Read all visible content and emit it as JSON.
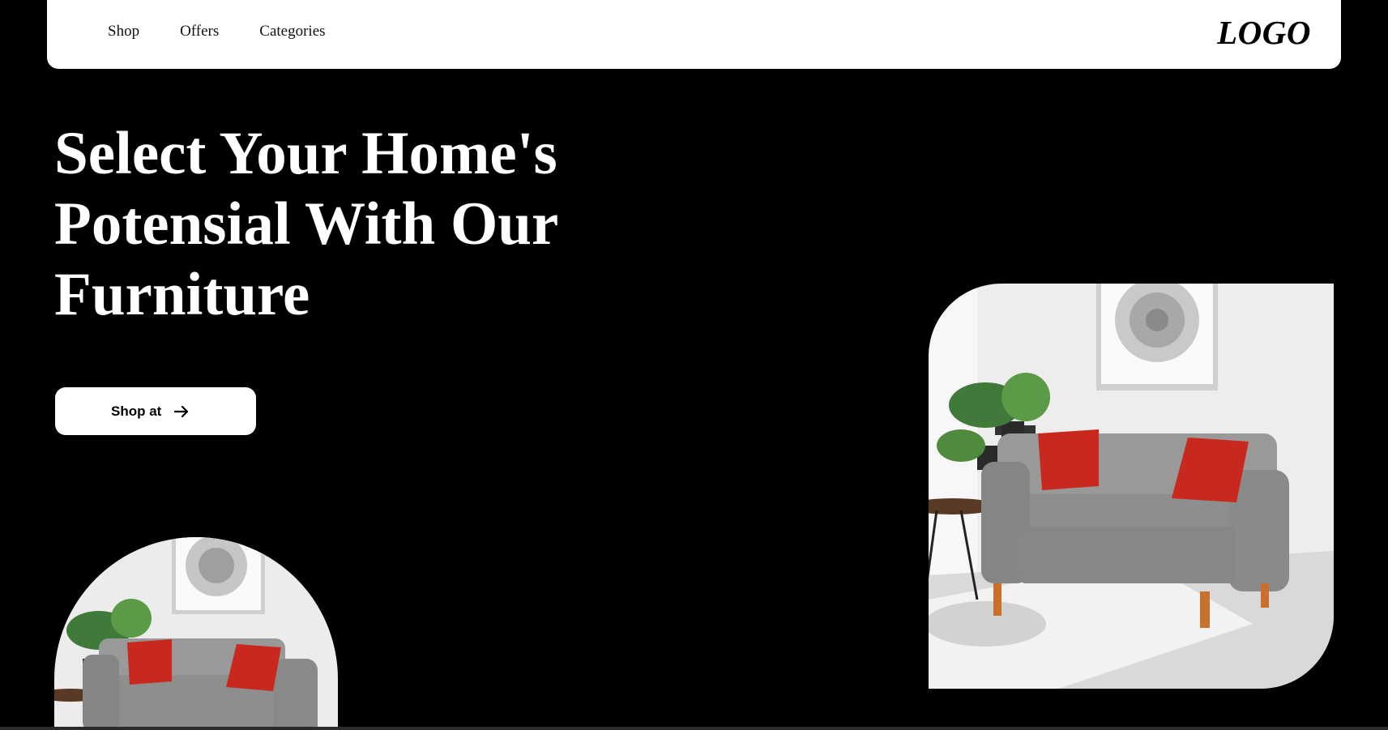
{
  "nav": {
    "links": [
      "Shop",
      "Offers",
      "Categories"
    ],
    "logo": "LOGO"
  },
  "hero": {
    "title_lines": [
      "Select Your Home's",
      "Potensial With Our",
      "Furniture"
    ],
    "cta_label": "Shop at",
    "cta_icon": "arrow-right-icon"
  },
  "images": {
    "right": "living-room-sofa-photo",
    "left": "living-room-sofa-photo"
  },
  "colors": {
    "background": "#000000",
    "navbar": "#ffffff",
    "title": "#ffffff",
    "button": "#ffffff",
    "sofa_gray": "#8e8e8e",
    "pillow_red": "#c8281e"
  }
}
